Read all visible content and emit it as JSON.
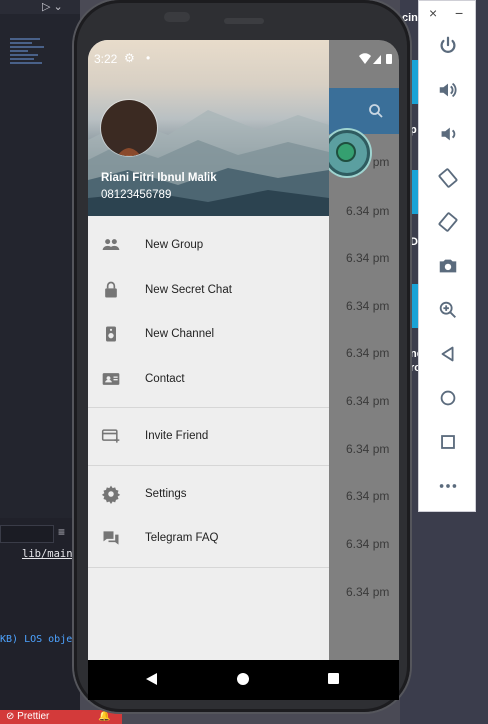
{
  "ide": {
    "run_glyph": "▷ ⌄",
    "file_label": "lib/main",
    "log_text": "KB) LOS obje",
    "status_prettier": "⊘ Prettier",
    "status_bell": "🔔",
    "menu_glyph": "≡"
  },
  "right_bg": {
    "fragments": [
      "cin",
      "D",
      "ne",
      "ro",
      "p"
    ]
  },
  "emulator": {
    "close_label": "×",
    "minimize_label": "−",
    "buttons": [
      "power-icon",
      "volume-up-icon",
      "volume-down-icon",
      "rotate-left-icon",
      "rotate-right-icon",
      "camera-icon",
      "zoom-icon",
      "back-icon",
      "home-icon",
      "overview-icon",
      "more-icon"
    ]
  },
  "status_bar": {
    "time": "3:22",
    "gear": "⚙",
    "dot": "•"
  },
  "drawer": {
    "user_name": "Riani Fitri Ibnul Malik",
    "user_phone": "08123456789",
    "items": [
      {
        "label": "New Group",
        "icon": "group-icon"
      },
      {
        "label": "New Secret Chat",
        "icon": "lock-icon"
      },
      {
        "label": "New Channel",
        "icon": "speaker-icon"
      },
      {
        "label": "Contact",
        "icon": "contact-card-icon"
      },
      {
        "label": "Invite Friend",
        "icon": "invite-card-icon"
      },
      {
        "label": "Settings",
        "icon": "settings-icon"
      },
      {
        "label": "Telegram FAQ",
        "icon": "faq-icon"
      }
    ]
  },
  "chat_times": [
    "6.34 pm",
    "6.34 pm",
    "6.34 pm",
    "6.34 pm",
    "6.34 pm",
    "6.34 pm",
    "6.34 pm",
    "6.34 pm",
    "6.34 pm",
    "6.34 pm"
  ],
  "colors": {
    "app_bar": "#3a6f99",
    "drawer_bg": "#eeeeee",
    "overlay": "#808080"
  }
}
